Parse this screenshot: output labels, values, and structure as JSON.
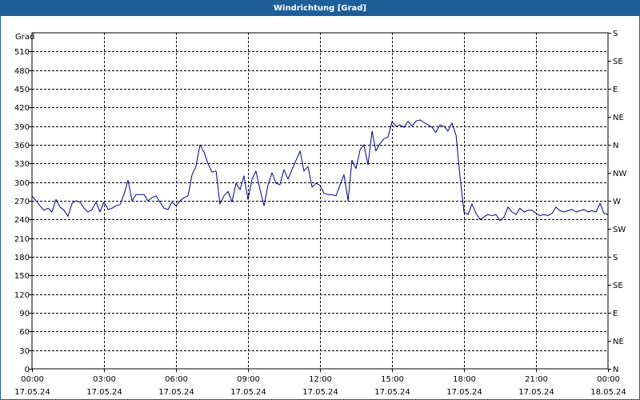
{
  "window": {
    "title": "Windrichtung [Grad]"
  },
  "chart_data": {
    "type": "line",
    "title": "Windrichtung [Grad]",
    "ylabel": "Grad",
    "ylim": [
      0,
      540
    ],
    "y_ticks": [
      0,
      30,
      60,
      90,
      120,
      150,
      180,
      210,
      240,
      270,
      300,
      330,
      360,
      390,
      420,
      450,
      480,
      510
    ],
    "x_range_hours": [
      0,
      24
    ],
    "x_ticks": [
      {
        "hour": 0,
        "time": "00:00",
        "date": "17.05.24"
      },
      {
        "hour": 3,
        "time": "03:00",
        "date": "17.05.24"
      },
      {
        "hour": 6,
        "time": "06:00",
        "date": "17.05.24"
      },
      {
        "hour": 9,
        "time": "09:00",
        "date": "17.05.24"
      },
      {
        "hour": 12,
        "time": "12:00",
        "date": "17.05.24"
      },
      {
        "hour": 15,
        "time": "15:00",
        "date": "17.05.24"
      },
      {
        "hour": 18,
        "time": "18:00",
        "date": "17.05.24"
      },
      {
        "hour": 21,
        "time": "21:00",
        "date": "17.05.24"
      },
      {
        "hour": 24,
        "time": "00:00",
        "date": "18.05.24"
      }
    ],
    "right_axis_labels": [
      {
        "value": 0,
        "label": "N"
      },
      {
        "value": 45,
        "label": "NE"
      },
      {
        "value": 90,
        "label": "E"
      },
      {
        "value": 135,
        "label": "SE"
      },
      {
        "value": 180,
        "label": "S"
      },
      {
        "value": 225,
        "label": "SW"
      },
      {
        "value": 270,
        "label": "W"
      },
      {
        "value": 315,
        "label": "NW"
      },
      {
        "value": 360,
        "label": "N"
      },
      {
        "value": 405,
        "label": "NE"
      },
      {
        "value": 450,
        "label": "E"
      },
      {
        "value": 495,
        "label": "SE"
      },
      {
        "value": 540,
        "label": "S"
      }
    ],
    "grid": true,
    "series_color": "#000080",
    "series": [
      {
        "x": [
          0,
          0.17,
          0.33,
          0.5,
          0.67,
          0.83,
          1.0,
          1.17,
          1.33,
          1.5,
          1.67,
          1.83,
          2.0,
          2.17,
          2.33,
          2.5,
          2.67,
          2.83,
          3.0,
          3.17,
          3.33,
          3.5,
          3.67,
          3.83,
          4.0,
          4.17,
          4.33,
          4.5,
          4.67,
          4.83,
          5.0,
          5.17,
          5.33,
          5.5,
          5.67,
          5.83,
          6.0,
          6.17,
          6.33,
          6.5,
          6.67,
          6.83,
          7.0,
          7.17,
          7.33,
          7.5,
          7.67,
          7.83,
          8.0,
          8.17,
          8.33,
          8.5,
          8.67,
          8.83,
          9.0,
          9.17,
          9.33,
          9.5,
          9.67,
          9.83,
          10.0,
          10.17,
          10.33,
          10.5,
          10.67,
          10.83,
          11.0,
          11.17,
          11.33,
          11.5,
          11.67,
          11.83,
          12.0,
          12.17,
          12.33,
          12.5,
          12.67,
          12.83,
          13.0,
          13.17,
          13.33,
          13.5,
          13.67,
          13.83,
          14.0,
          14.17,
          14.33,
          14.5,
          14.67,
          14.83,
          15.0,
          15.17,
          15.33,
          15.5,
          15.67,
          15.83,
          16.0,
          16.17,
          16.33,
          16.5,
          16.67,
          16.83,
          17.0,
          17.17,
          17.33,
          17.5,
          17.67,
          17.83,
          18.0,
          18.17,
          18.33,
          18.5,
          18.67,
          18.83,
          19.0,
          19.17,
          19.33,
          19.5,
          19.67,
          19.83,
          20.0,
          20.17,
          20.33,
          20.5,
          20.67,
          20.83,
          21.0,
          21.17,
          21.33,
          21.5,
          21.67,
          21.83,
          22.0,
          22.17,
          22.33,
          22.5,
          22.67,
          22.83,
          23.0,
          23.17,
          23.33,
          23.5,
          23.67,
          23.83,
          24.0
        ],
        "y": [
          278,
          270,
          262,
          255,
          258,
          252,
          272,
          260,
          255,
          245,
          266,
          270,
          268,
          258,
          252,
          256,
          268,
          252,
          268,
          256,
          258,
          262,
          264,
          280,
          303,
          270,
          280,
          280,
          280,
          270,
          275,
          278,
          268,
          258,
          256,
          268,
          262,
          270,
          275,
          278,
          312,
          325,
          360,
          348,
          330,
          316,
          318,
          265,
          278,
          285,
          268,
          298,
          288,
          310,
          272,
          305,
          318,
          288,
          262,
          295,
          315,
          298,
          296,
          320,
          305,
          320,
          335,
          350,
          318,
          325,
          292,
          298,
          295,
          282,
          280,
          280,
          278,
          295,
          312,
          270,
          335,
          322,
          352,
          360,
          328,
          382,
          350,
          362,
          370,
          372,
          397,
          390,
          392,
          388,
          398,
          390,
          398,
          400,
          396,
          392,
          388,
          380,
          392,
          390,
          382,
          395,
          375,
          310,
          252,
          248,
          265,
          250,
          240,
          244,
          248,
          246,
          248,
          238,
          244,
          260,
          252,
          248,
          258,
          252,
          255,
          255,
          250,
          246,
          248,
          246,
          250,
          260,
          254,
          252,
          254,
          256,
          252,
          254,
          256,
          252,
          254,
          252,
          266,
          250,
          248
        ]
      }
    ]
  }
}
